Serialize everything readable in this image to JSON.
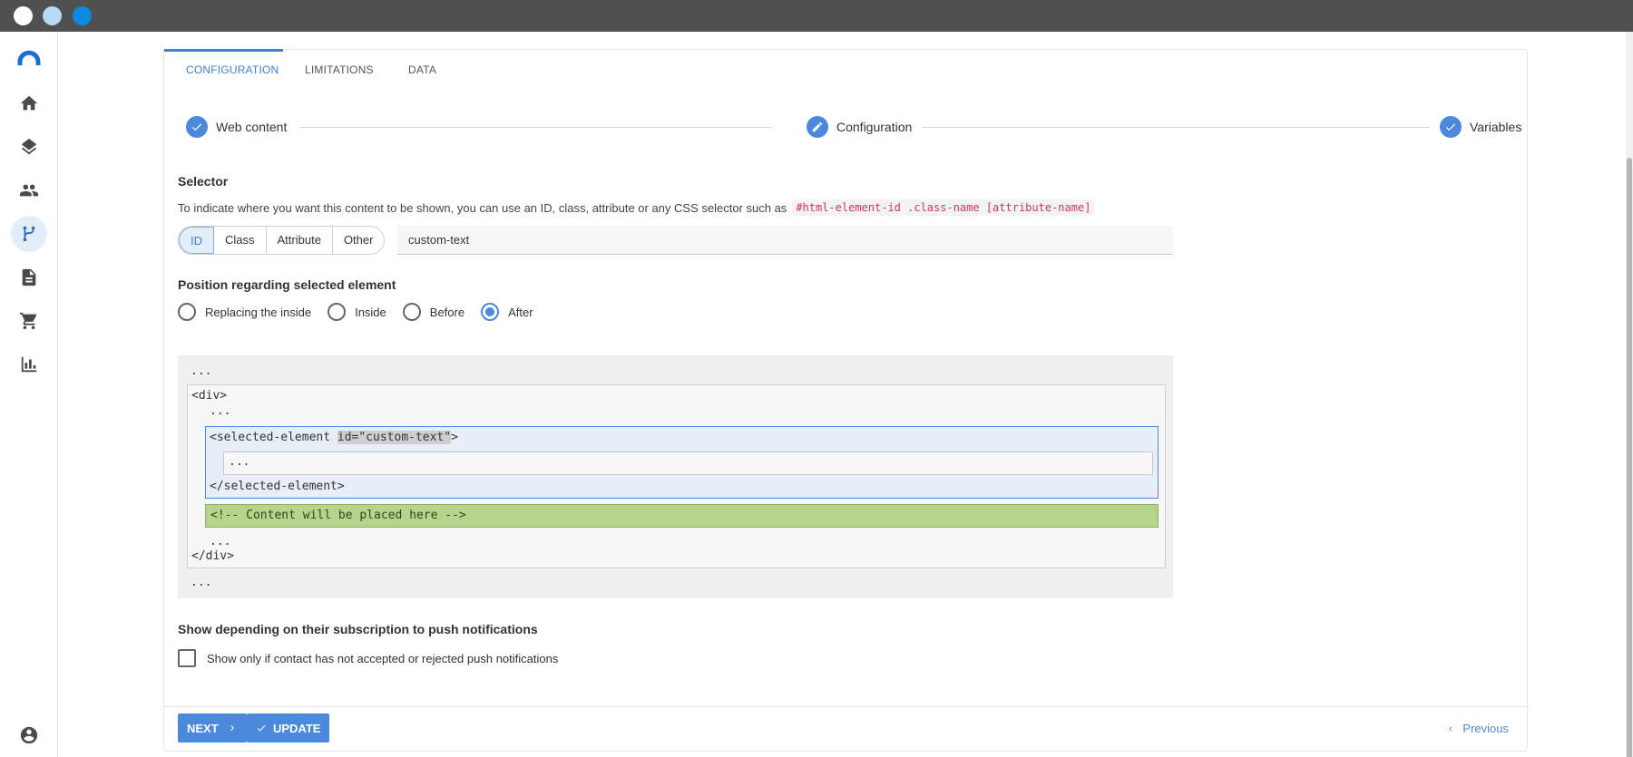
{
  "tabs": [
    {
      "label": "CONFIGURATION"
    },
    {
      "label": "LIMITATIONS"
    },
    {
      "label": "DATA"
    }
  ],
  "stepper": [
    {
      "label": "Web content",
      "icon": "check-icon"
    },
    {
      "label": "Configuration",
      "icon": "pencil-icon"
    },
    {
      "label": "Variables",
      "icon": "check-icon"
    }
  ],
  "selector": {
    "title": "Selector",
    "hint": "To indicate where you want this content to be shown, you can use an ID, class, attribute or any CSS selector such as",
    "example": "#html-element-id .class-name [attribute-name]",
    "types": [
      "ID",
      "Class",
      "Attribute",
      "Other"
    ],
    "selected_type": "ID",
    "value": "custom-text"
  },
  "position": {
    "title": "Position regarding selected element",
    "options": [
      "Replacing the inside",
      "Inside",
      "Before",
      "After"
    ],
    "selected": "After"
  },
  "code_preview": {
    "ellipsis": "...",
    "div_open": "<div>",
    "div_close": "</div>",
    "selected_open_prefix": "<selected-element ",
    "selected_attr": "id=\"custom-text\"",
    "selected_open_suffix": ">",
    "selected_close": "</selected-element>",
    "placeholder": "<!-- Content will be placed here -->"
  },
  "push": {
    "title": "Show depending on their subscription to push notifications",
    "checkbox_label": "Show only if contact has not accepted or rejected push notifications",
    "checked": false
  },
  "footer": {
    "next_label": "NEXT",
    "update_label": "UPDATE",
    "previous_label": "Previous"
  },
  "colors": {
    "accent": "#4a89dc",
    "code_highlight": "#b7d48c",
    "code_chip_text": "#d6336c"
  }
}
